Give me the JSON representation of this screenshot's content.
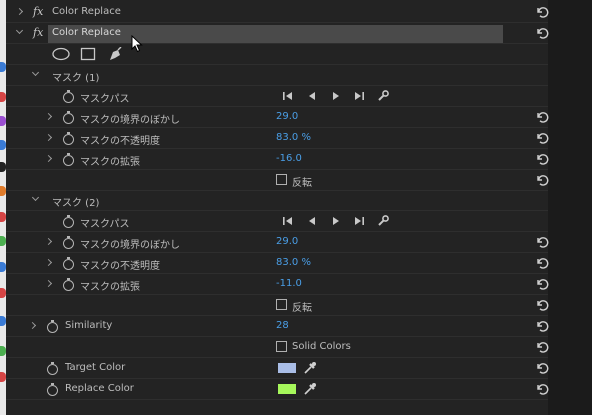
{
  "effect_collapsed": {
    "title": "Color Replace"
  },
  "effect_expanded": {
    "title": "Color Replace"
  },
  "mask1": {
    "title": "マスク (1)",
    "path_label": "マスクパス",
    "feather_label": "マスクの境界のぼかし",
    "feather_value": "29.0",
    "opacity_label": "マスクの不透明度",
    "opacity_value": "83.0 %",
    "expansion_label": "マスクの拡張",
    "expansion_value": "-16.0",
    "invert_label": "反転"
  },
  "mask2": {
    "title": "マスク (2)",
    "path_label": "マスクパス",
    "feather_label": "マスクの境界のぼかし",
    "feather_value": "29.0",
    "opacity_label": "マスクの不透明度",
    "opacity_value": "83.0 %",
    "expansion_label": "マスクの拡張",
    "expansion_value": "-11.0",
    "invert_label": "反転"
  },
  "similarity": {
    "label": "Similarity",
    "value": "28"
  },
  "solid_colors": {
    "label": "Solid Colors"
  },
  "target_color": {
    "label": "Target Color",
    "color": "#a9bde6"
  },
  "replace_color": {
    "label": "Replace Color",
    "color": "#a6f75b"
  },
  "colors": {
    "accent_value": "#4a9ee6",
    "panel_bg": "#232323",
    "row_highlight": "#4a4a4a"
  },
  "icons": {
    "reset": "reset-icon",
    "stopwatch": "stopwatch-icon",
    "mask_tools": [
      "ellipse-mask-icon",
      "rectangle-mask-icon",
      "pen-mask-icon"
    ],
    "track_tools": [
      "track-back-one-icon",
      "track-back-frame-icon",
      "track-forward-frame-icon",
      "track-forward-one-icon",
      "track-settings-icon"
    ]
  }
}
